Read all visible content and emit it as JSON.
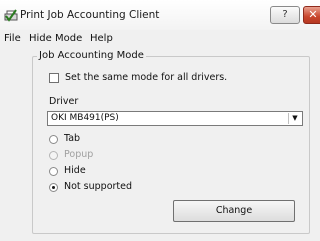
{
  "window": {
    "title": "Print Job Accounting Client",
    "help_button": "?",
    "close_button": "✕"
  },
  "menubar": {
    "items": [
      "File",
      "Hide Mode",
      "Help"
    ]
  },
  "group": {
    "title": "Job Accounting Mode",
    "same_mode_checkbox": {
      "label": "Set the same mode for all drivers.",
      "checked": false
    },
    "driver_label": "Driver",
    "driver_select": {
      "value": "OKI MB491(PS)"
    },
    "radios": [
      {
        "label": "Tab",
        "checked": false,
        "enabled": true
      },
      {
        "label": "Popup",
        "checked": false,
        "enabled": false
      },
      {
        "label": "Hide",
        "checked": false,
        "enabled": true
      },
      {
        "label": "Not supported",
        "checked": true,
        "enabled": true
      }
    ],
    "change_button": "Change"
  }
}
